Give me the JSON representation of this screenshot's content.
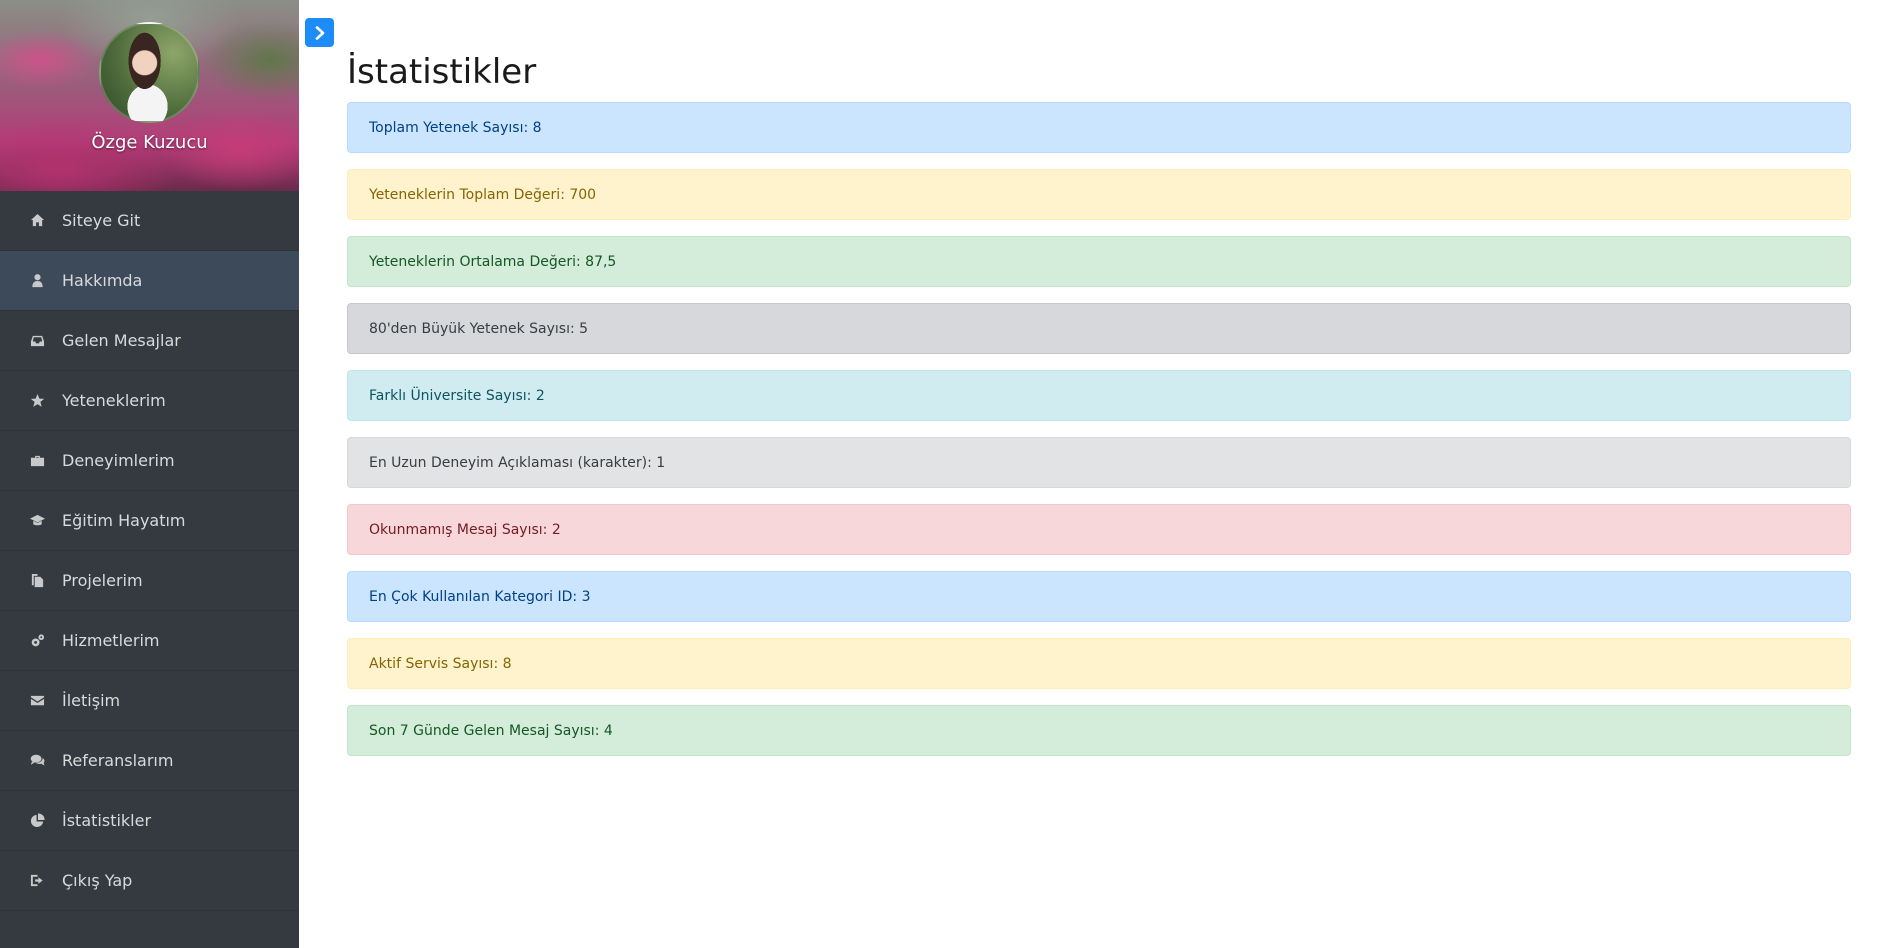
{
  "sidebar": {
    "profile_name": "Özge Kuzucu",
    "items": [
      {
        "label": "Siteye Git",
        "icon": "home-icon"
      },
      {
        "label": "Hakkımda",
        "icon": "user-icon",
        "active": true
      },
      {
        "label": "Gelen Mesajlar",
        "icon": "inbox-icon"
      },
      {
        "label": "Yeteneklerim",
        "icon": "star-icon"
      },
      {
        "label": "Deneyimlerim",
        "icon": "briefcase-icon"
      },
      {
        "label": "Eğitim Hayatım",
        "icon": "graduation-cap-icon"
      },
      {
        "label": "Projelerim",
        "icon": "files-icon"
      },
      {
        "label": "Hizmetlerim",
        "icon": "cogs-icon"
      },
      {
        "label": "İletişim",
        "icon": "envelope-icon"
      },
      {
        "label": "Referanslarım",
        "icon": "comments-icon"
      },
      {
        "label": "İstatistikler",
        "icon": "pie-chart-icon"
      },
      {
        "label": "Çıkış Yap",
        "icon": "sign-out-icon"
      }
    ]
  },
  "toggle": {
    "icon": "chevron-right-icon",
    "color": "#1d8cf8"
  },
  "main": {
    "title": "İstatistikler",
    "stats": [
      {
        "text": "Toplam Yetenek Sayısı: 8",
        "variant": "primary"
      },
      {
        "text": "Yeteneklerin Toplam Değeri: 700",
        "variant": "warning"
      },
      {
        "text": "Yeteneklerin Ortalama Değeri: 87,5",
        "variant": "success"
      },
      {
        "text": "80'den Büyük Yetenek Sayısı: 5",
        "variant": "secondary"
      },
      {
        "text": "Farklı Üniversite Sayısı: 2",
        "variant": "info"
      },
      {
        "text": "En Uzun Deneyim Açıklaması (karakter): 1",
        "variant": "light"
      },
      {
        "text": "Okunmamış Mesaj Sayısı: 2",
        "variant": "danger"
      },
      {
        "text": "En Çok Kullanılan Kategori ID: 3",
        "variant": "primary"
      },
      {
        "text": "Aktif Servis Sayısı: 8",
        "variant": "warning"
      },
      {
        "text": "Son 7 Günde Gelen Mesaj Sayısı: 4",
        "variant": "success"
      }
    ]
  }
}
